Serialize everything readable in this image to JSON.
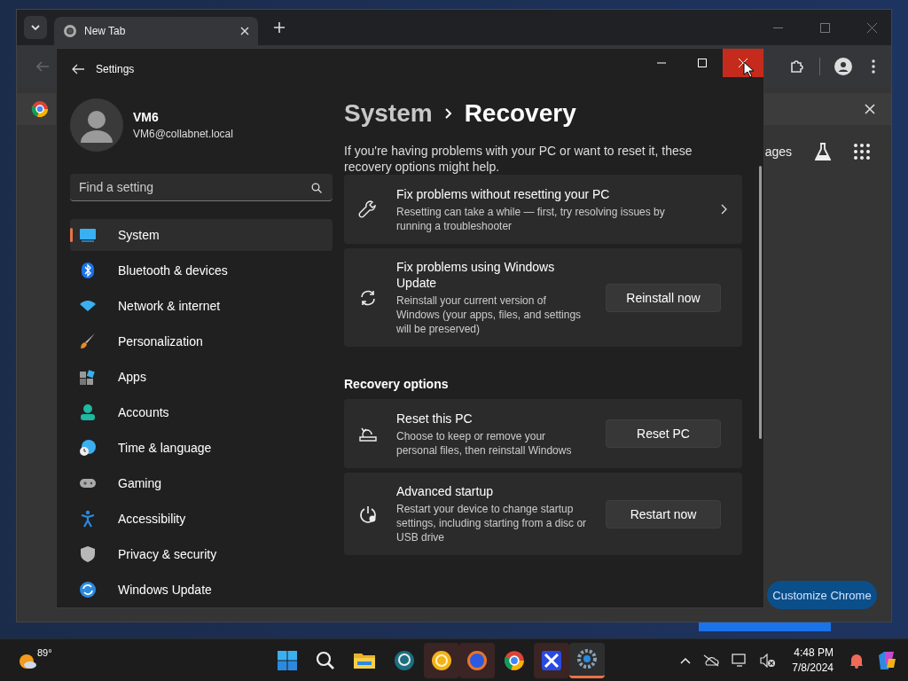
{
  "browser": {
    "tab": {
      "title": "New Tab"
    },
    "side_panel": {
      "partial_link": "ages",
      "customize_button": "Customize Chrome"
    }
  },
  "settings": {
    "title": "Settings",
    "user": {
      "name": "VM6",
      "email": "VM6@collabnet.local"
    },
    "search": {
      "placeholder": "Find a setting"
    },
    "nav": [
      {
        "label": "System",
        "selected": true
      },
      {
        "label": "Bluetooth & devices",
        "selected": false
      },
      {
        "label": "Network & internet",
        "selected": false
      },
      {
        "label": "Personalization",
        "selected": false
      },
      {
        "label": "Apps",
        "selected": false
      },
      {
        "label": "Accounts",
        "selected": false
      },
      {
        "label": "Time & language",
        "selected": false
      },
      {
        "label": "Gaming",
        "selected": false
      },
      {
        "label": "Accessibility",
        "selected": false
      },
      {
        "label": "Privacy & security",
        "selected": false
      },
      {
        "label": "Windows Update",
        "selected": false
      }
    ],
    "breadcrumb": {
      "parent": "System",
      "current": "Recovery"
    },
    "description": "If you're having problems with your PC or want to reset it, these recovery options might help.",
    "cards": [
      {
        "kind": "link",
        "title": "Fix problems without resetting your PC",
        "subtitle": "Resetting can take a while — first, try resolving issues by running a troubleshooter"
      },
      {
        "kind": "button",
        "title": "Fix problems using Windows Update",
        "subtitle": "Reinstall your current version of Windows (your apps, files, and settings will be preserved)",
        "button": "Reinstall now"
      }
    ],
    "section_heading": "Recovery options",
    "options": [
      {
        "kind": "button",
        "title": "Reset this PC",
        "subtitle": "Choose to keep or remove your personal files, then reinstall Windows",
        "button": "Reset PC"
      },
      {
        "kind": "button",
        "title": "Advanced startup",
        "subtitle": "Restart your device to change startup settings, including starting from a disc or USB drive",
        "button": "Restart now"
      }
    ]
  },
  "taskbar": {
    "weather": "89°",
    "time": "4:48 PM",
    "date": "7/8/2024"
  }
}
